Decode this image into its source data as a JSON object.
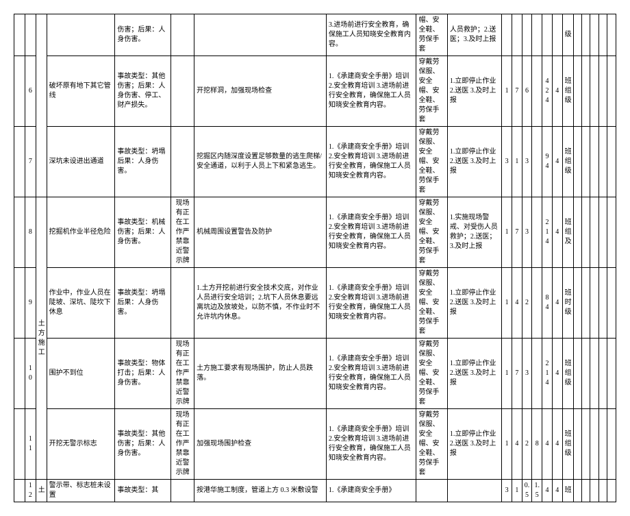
{
  "rows": [
    {
      "idxL": "",
      "idxR": "",
      "cat": "",
      "hazard": "",
      "accident": "伤害；后果：人身伤害。",
      "site": "",
      "measure": "",
      "training": "3.进场前进行安全教育，确保施工人员知晓安全教育内容。",
      "ppe": "帽、安全鞋、劳保手套",
      "emergency": "人员救护；2.送医；3.及时上报",
      "n1": "",
      "n2": "",
      "n3": "",
      "n4": "",
      "n5": "",
      "n6": "",
      "lvl": "级",
      "t1": "",
      "t2": "",
      "t3": "",
      "t4": "",
      "t5": ""
    },
    {
      "idxL": "",
      "idxR": "6",
      "cat": "",
      "hazard": "破坏原有地下其它管线",
      "accident": "事故类型：其他伤害；后果：人身伤害、停工、财产损失。",
      "site": "",
      "measure": "开挖样洞，加强现场检查",
      "training": "1.《承建商安全手册》培训 2.安全教育培训 3.进场前进行安全教育，确保施工人员知晓安全教育内容。",
      "ppe": "穿戴劳保服、安全帽、安全鞋、劳保手套",
      "emergency": "1.立即停止作业 2.送医 3.及时上报",
      "n1": "1",
      "n2": "7",
      "n3": "6",
      "n4": "",
      "n5": "424",
      "n6": "4",
      "lvl": "班组级",
      "t1": "",
      "t2": "",
      "t3": "",
      "t4": "",
      "t5": ""
    },
    {
      "idxL": "",
      "idxR": "7",
      "cat": "",
      "hazard": "深坑未设进出通道",
      "accident": "事故类型：坍塌 后果：人身伤害。",
      "site": "",
      "measure": "挖掘区内随深度设置足够数量的逃生爬梯/安全通道，以利于人员上下和紧急逃生。",
      "training": "1.《承建商安全手册》培训 2.安全教育培训 3.进场前进行安全教育，确保施工人员知晓安全教育内容。",
      "ppe": "穿戴劳保服、安全帽、安全鞋、劳保手套",
      "emergency": "1.立即停止作业 2.送医 3.及时上报",
      "n1": "3",
      "n2": "1",
      "n3": "3",
      "n4": "",
      "n5": "94",
      "n6": "4",
      "lvl": "班组级",
      "t1": "",
      "t2": "",
      "t3": "",
      "t4": "",
      "t5": ""
    },
    {
      "idxL": "",
      "idxR": "8",
      "cat_rowspan_text": "土方施工",
      "hazard": "挖掘机作业半径危险",
      "accident": "事故类型：机械伤害；后果：人身伤害。",
      "site": "现场有正在工作严禁靠近警示牌",
      "measure": "机械周围设置警告及防护",
      "training": "1.《承建商安全手册》培训 2.安全教育培训 3.进场前进行安全教育，确保施工人员知晓安全教育内容。",
      "ppe": "穿戴劳保服、安全帽、安全鞋、劳保手套",
      "emergency": "1.实施现场警戒、对受伤人员救护；2.送医；3.及时上报",
      "n1": "1",
      "n2": "7",
      "n3": "3",
      "n4": "",
      "n5": "214",
      "n6": "4",
      "lvl": "班组及",
      "t1": "",
      "t2": "",
      "t3": "",
      "t4": "",
      "t5": ""
    },
    {
      "idxL": "",
      "idxR": "9",
      "hazard": "作业中，作业人员在陡坡、深坑、陡坎下休息",
      "accident": "事故类型：坍塌 后果：人身伤害。",
      "site": "",
      "measure": "1.土方开挖前进行安全技术交底，对作业人员进行安全培训；2.坑下人员休息要远离坑边及放坡处，以防不慎，不作业时不允许坑内休息。",
      "training": "1.《承建商安全手册》培训 2.安全教育培训 3.进场前进行安全教育，确保施工人员知晓安全教育内容。",
      "ppe": "穿戴劳保服、安全帽、安全鞋、劳保手套",
      "emergency": "1.立即停止作业 2.送医 3.及时上报",
      "n1": "1",
      "n2": "4",
      "n3": "2",
      "n4": "",
      "n5": "84",
      "n6": "4",
      "lvl": "班时级",
      "t1": "",
      "t2": "",
      "t3": "",
      "t4": "",
      "t5": ""
    },
    {
      "idxL": "",
      "idxR": "10",
      "hazard": "围护不到位",
      "accident": "事故类型：物体打击；后果：人身伤害。",
      "site": "现场有正在工作严禁靠近警示牌",
      "measure": "土方施工要求有现场围护，防止人员跌落。",
      "training": "1.《承建商安全手册》培训 2.安全教育培训 3.进场前进行安全教育，确保施工人员知晓安全教育内容。",
      "ppe": "穿戴劳保服、安全帽、安全鞋、劳保手套",
      "emergency": "1.立即停止作业 2.送医 3.及时上报",
      "n1": "1",
      "n2": "7",
      "n3": "3",
      "n4": "",
      "n5": "214",
      "n6": "4",
      "lvl": "班组级",
      "t1": "",
      "t2": "",
      "t3": "",
      "t4": "",
      "t5": ""
    },
    {
      "idxL": "",
      "idxR": "11",
      "hazard": "开挖无警示标志",
      "accident": "事故类型：其他伤害；后果：人身伤害。",
      "site": "现场有正在工作严禁靠近警示牌",
      "measure": "加强现场围护检查",
      "training": "1.《承建商安全手册》培训 2.安全教育培训 3.进场前进行安全教育，确保施工人员知晓安全教育内容。",
      "ppe": "穿戴劳保服、安全帽、安全鞋、劳保手套",
      "emergency": "1.立即停止作业 2.送医 3.及时上报",
      "n1": "1",
      "n2": "4",
      "n3": "2",
      "n4": "8",
      "n5": "4",
      "n6": "4",
      "lvl": "班组级",
      "t1": "",
      "t2": "",
      "t3": "",
      "t4": "",
      "t5": ""
    },
    {
      "idxL": "",
      "idxR": "12",
      "cat": "土",
      "hazard": "警示带、标志桩未设置",
      "accident": "事故类型：其",
      "site": "",
      "measure": "按港华施工制度，管道上方 0.3 米敷设警",
      "training": "1.《承建商安全手册》",
      "ppe": "",
      "emergency": "",
      "n1": "3",
      "n2": "1",
      "n3": "0.5",
      "n4": "1.5",
      "n5": "4",
      "n6": "4",
      "lvl": "班",
      "t1": "",
      "t2": "",
      "t3": "",
      "t4": "",
      "t5": ""
    }
  ]
}
